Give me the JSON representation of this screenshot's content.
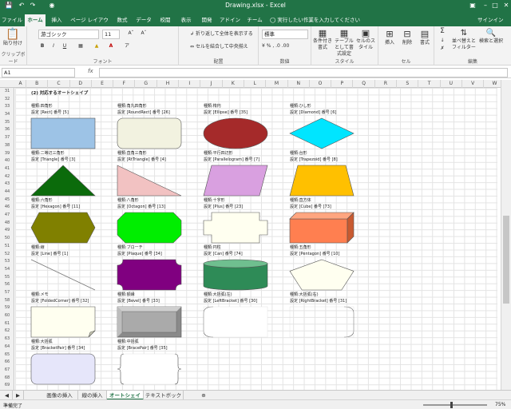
{
  "titlebar": {
    "title": "Drawing.xlsx - Excel",
    "save_icon": "save-icon",
    "undo_icon": "undo-icon",
    "redo_icon": "redo-icon",
    "camera_icon": "camera-icon"
  },
  "ribbon_tabs": [
    "ファイル",
    "ホーム",
    "挿入",
    "ページ レイアウト",
    "数式",
    "データ",
    "校閲",
    "表示",
    "開発",
    "アドイン",
    "チーム"
  ],
  "active_tab": "ホーム",
  "tell_me": "実行したい作業を入力してください",
  "signin": "サインイン",
  "ribbon": {
    "clipboard": {
      "label": "クリップボード",
      "paste": "貼り付け"
    },
    "font": {
      "label": "フォント",
      "name": "游ゴシック",
      "size": "11",
      "bold": "B",
      "italic": "I",
      "underline": "U"
    },
    "alignment": {
      "label": "配置",
      "wrap": "折り返して全体を表示する",
      "merge": "セルを結合して中央揃え"
    },
    "number": {
      "label": "数値",
      "format": "標準"
    },
    "styles": {
      "label": "スタイル",
      "conditional": "条件付き書式",
      "table": "テーブルとして書式設定",
      "cell": "セルのスタイル"
    },
    "cells": {
      "label": "セル",
      "insert": "挿入",
      "delete": "削除",
      "format": "書式"
    },
    "editing": {
      "label": "編集",
      "sort": "並べ替えとフィルター",
      "find": "検索と選択"
    }
  },
  "formula": {
    "namebox": "A1",
    "fx": "fx"
  },
  "columns": [
    "A",
    "B",
    "C",
    "D",
    "E",
    "F",
    "G",
    "H",
    "I",
    "J",
    "K",
    "L",
    "M",
    "N",
    "O",
    "P",
    "Q",
    "R",
    "S",
    "T",
    "U",
    "V",
    "W"
  ],
  "rows": [
    "31",
    "32",
    "33",
    "34",
    "35",
    "36",
    "37",
    "38",
    "39",
    "40",
    "41",
    "42",
    "43",
    "44",
    "45",
    "46",
    "47",
    "48",
    "49",
    "50",
    "51",
    "52",
    "53",
    "54",
    "55",
    "56",
    "57",
    "58",
    "59",
    "60",
    "61",
    "62",
    "63",
    "64",
    "65",
    "66",
    "67",
    "68",
    "69"
  ],
  "section_title": "(2) 対応するオートシェイプ",
  "shapes": [
    {
      "name": "種類:四角形",
      "code": "設定 [Rect] 番号 [5]",
      "fill": "#9dc3e6"
    },
    {
      "name": "種類:角丸四角形",
      "code": "設定 [RoundRect] 番号 [26]",
      "fill": "#f2f2e0"
    },
    {
      "name": "種類:楕円",
      "code": "設定 [Ellipse] 番号 [35]",
      "fill": "#a52a2a"
    },
    {
      "name": "種類:ひし形",
      "code": "設定 [Diamond] 番号 [6]",
      "fill": "#00e5ff"
    },
    {
      "name": "種類:二等辺三角形",
      "code": "設定 [Triangle] 番号 [3]",
      "fill": "#0b6b0b"
    },
    {
      "name": "種類:直角三角形",
      "code": "設定 [RtTriangle] 番号 [4]",
      "fill": "#f2c2c2"
    },
    {
      "name": "種類:平行四辺形",
      "code": "設定 [Parallelogram] 番号 [7]",
      "fill": "#d9a0e0"
    },
    {
      "name": "種類:台形",
      "code": "設定 [Trapezoid] 番号 [8]",
      "fill": "#ffc000"
    },
    {
      "name": "種類:六角形",
      "code": "設定 [Hexagon] 番号 [11]",
      "fill": "#808000"
    },
    {
      "name": "種類:八角形",
      "code": "設定 [Octagon] 番号 [13]",
      "fill": "#00ee00"
    },
    {
      "name": "種類:十字形",
      "code": "設定 [Plus] 番号 [23]",
      "fill": "#fffff0"
    },
    {
      "name": "種類:直方体",
      "code": "設定 [Cube] 番号 [73]",
      "fill": "#ff7f50"
    },
    {
      "name": "種類:線",
      "code": "設定 [Line] 番号 [1]",
      "fill": "#888888"
    },
    {
      "name": "種類:ブローチ",
      "code": "設定 [Plaque] 番号 [34]",
      "fill": "#800080"
    },
    {
      "name": "種類:円柱",
      "code": "設定 [Can] 番号 [74]",
      "fill": "#2e8b57"
    },
    {
      "name": "種類:五角形",
      "code": "設定 [Pentagon] 番号 [10]",
      "fill": "#fffff0"
    },
    {
      "name": "種類:メモ",
      "code": "設定 [FoldedCorner] 番号 [32]",
      "fill": "#fffff0"
    },
    {
      "name": "種類:額縁",
      "code": "設定 [Bevel] 番号 [33]",
      "fill": "#aaaaaa"
    },
    {
      "name": "種類:大括弧(左)",
      "code": "設定 [LeftBracket] 番号 [30]",
      "fill": "#ffffff"
    },
    {
      "name": "種類:大括弧(右)",
      "code": "設定 [RightBracket] 番号 [31]",
      "fill": "#ffffff"
    },
    {
      "name": "種類:大括弧",
      "code": "設定 [BracketPair] 番号 [34]",
      "fill": "#e6e6fa"
    },
    {
      "name": "種類:中括弧",
      "code": "設定 [BracePair] 番号 [35]",
      "fill": "#ffffff"
    }
  ],
  "sheet_tabs": [
    "画像の挿入",
    "線の挿入",
    "オートシェイプ",
    "テキストボックス"
  ],
  "active_sheet": "オートシェイプ",
  "status": {
    "text": "準備完了",
    "zoom": "75%"
  }
}
